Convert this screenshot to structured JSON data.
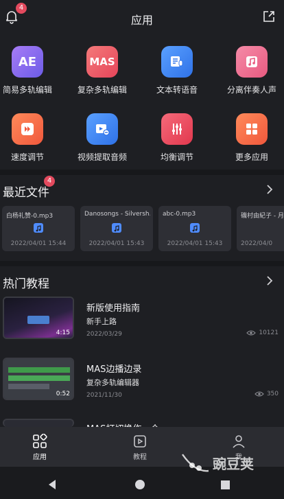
{
  "header": {
    "title": "应用",
    "notification_count": "4"
  },
  "apps": [
    {
      "label": "简易多轨编辑",
      "icon_text": "AE",
      "icon": "ae-icon",
      "color": "#8b6cf0"
    },
    {
      "label": "复杂多轨编辑",
      "icon_text": "MAS",
      "icon": "mas-icon",
      "color": "#ee5a6a"
    },
    {
      "label": "文本转语音",
      "icon_text": "",
      "icon": "text-to-speech-icon",
      "color": "#3b86f5"
    },
    {
      "label": "分离伴奏人声",
      "icon_text": "",
      "icon": "vocal-separation-icon",
      "color": "#f06a8a"
    },
    {
      "label": "速度调节",
      "icon_text": "",
      "icon": "speed-icon",
      "color": "#f56a4a"
    },
    {
      "label": "视频提取音频",
      "icon_text": "",
      "icon": "video-extract-icon",
      "color": "#3b86f5"
    },
    {
      "label": "均衡调节",
      "icon_text": "",
      "icon": "equalizer-icon",
      "color": "#ee4f5e"
    },
    {
      "label": "更多应用",
      "icon_text": "",
      "icon": "more-apps-icon",
      "color": "#f56a4a"
    }
  ],
  "recent": {
    "title": "最近文件",
    "count": "4",
    "files": [
      {
        "name": "白杨礼赞-0.mp3",
        "date": "2022/04/01 15:44"
      },
      {
        "name": "Danosongs - Silversh...",
        "date": "2022/04/01 15:43"
      },
      {
        "name": "abc-0.mp3",
        "date": "2022/04/01 15:43"
      },
      {
        "name": "磯村由紀子 - 月",
        "date": "2022/04/0"
      }
    ]
  },
  "tutorials": {
    "title": "热门教程",
    "items": [
      {
        "title": "新版使用指南",
        "subtitle": "新手上路",
        "date": "2022/03/29",
        "views": "10121",
        "duration": "4:15"
      },
      {
        "title": "MAS边播边录",
        "subtitle": "复杂多轨编辑器",
        "date": "2021/11/30",
        "views": "350",
        "duration": "0:52"
      },
      {
        "title": "MAS打切换作一个",
        "subtitle": "",
        "date": "",
        "views": "",
        "duration": ""
      }
    ]
  },
  "bottom_nav": [
    {
      "label": "应用",
      "icon": "apps-icon"
    },
    {
      "label": "教程",
      "icon": "tutorial-icon"
    },
    {
      "label": "我",
      "icon": "profile-icon"
    }
  ],
  "watermark": "豌豆荚"
}
